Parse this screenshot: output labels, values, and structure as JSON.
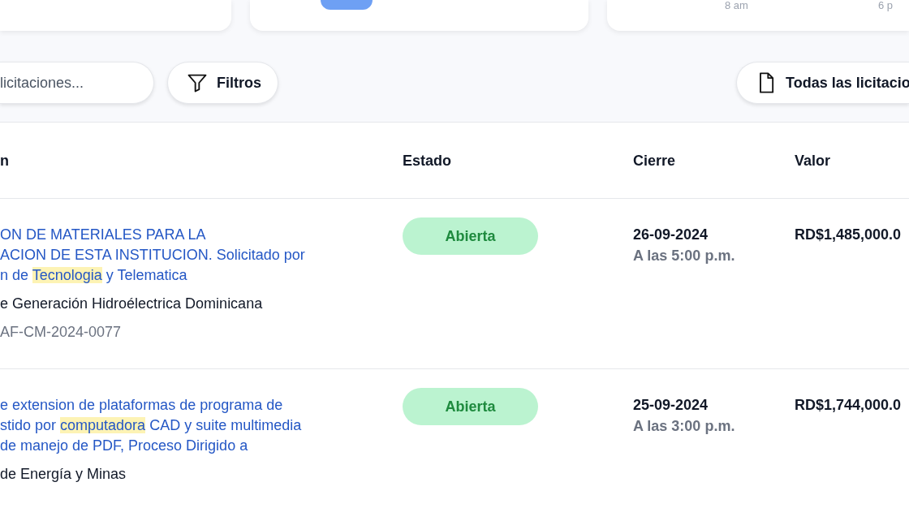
{
  "summary_cards": [
    {
      "kind": "blank"
    },
    {
      "kind": "circle"
    },
    {
      "kind": "axis",
      "labels": [
        "8 am",
        "6 p"
      ]
    }
  ],
  "toolbar": {
    "search": {
      "placeholder": "licitaciones..."
    },
    "filter_button": {
      "label": "Filtros"
    },
    "all_button": {
      "label": "Todas las licitacio"
    }
  },
  "table": {
    "columns": [
      "n",
      "Estado",
      "Cierre",
      "Valor"
    ],
    "rows": [
      {
        "title": [
          [
            {
              "text": "ON DE MATERIALES PARA LA",
              "highlight": false
            }
          ],
          [
            {
              "text": "ACION DE ESTA INSTITUCION. Solicitado por",
              "highlight": false
            }
          ],
          [
            {
              "text": "n de ",
              "highlight": false
            },
            {
              "text": "Tecnologia",
              "highlight": true
            },
            {
              "text": " y Telematica",
              "highlight": false
            }
          ]
        ],
        "institution": "e Generación Hidroélectrica Dominicana",
        "code": "AF-CM-2024-0077",
        "status": {
          "label": "Abierta",
          "kind": "open"
        },
        "close_date": "26-09-2024",
        "close_time": "A las 5:00 p.m.",
        "value": "RD$1,485,000.0"
      },
      {
        "title": [
          [
            {
              "text": "e extension de plataformas de programa de",
              "highlight": false
            }
          ],
          [
            {
              "text": "stido por ",
              "highlight": false
            },
            {
              "text": "computadora",
              "highlight": true
            },
            {
              "text": " CAD y suite multimedia",
              "highlight": false
            }
          ],
          [
            {
              "text": " de manejo de PDF, Proceso Dirigido a",
              "highlight": false
            }
          ]
        ],
        "institution": "de Energía y Minas",
        "status": {
          "label": "Abierta",
          "kind": "open"
        },
        "close_date": "25-09-2024",
        "close_time": "A las 3:00 p.m.",
        "value": "RD$1,744,000.0"
      }
    ]
  }
}
